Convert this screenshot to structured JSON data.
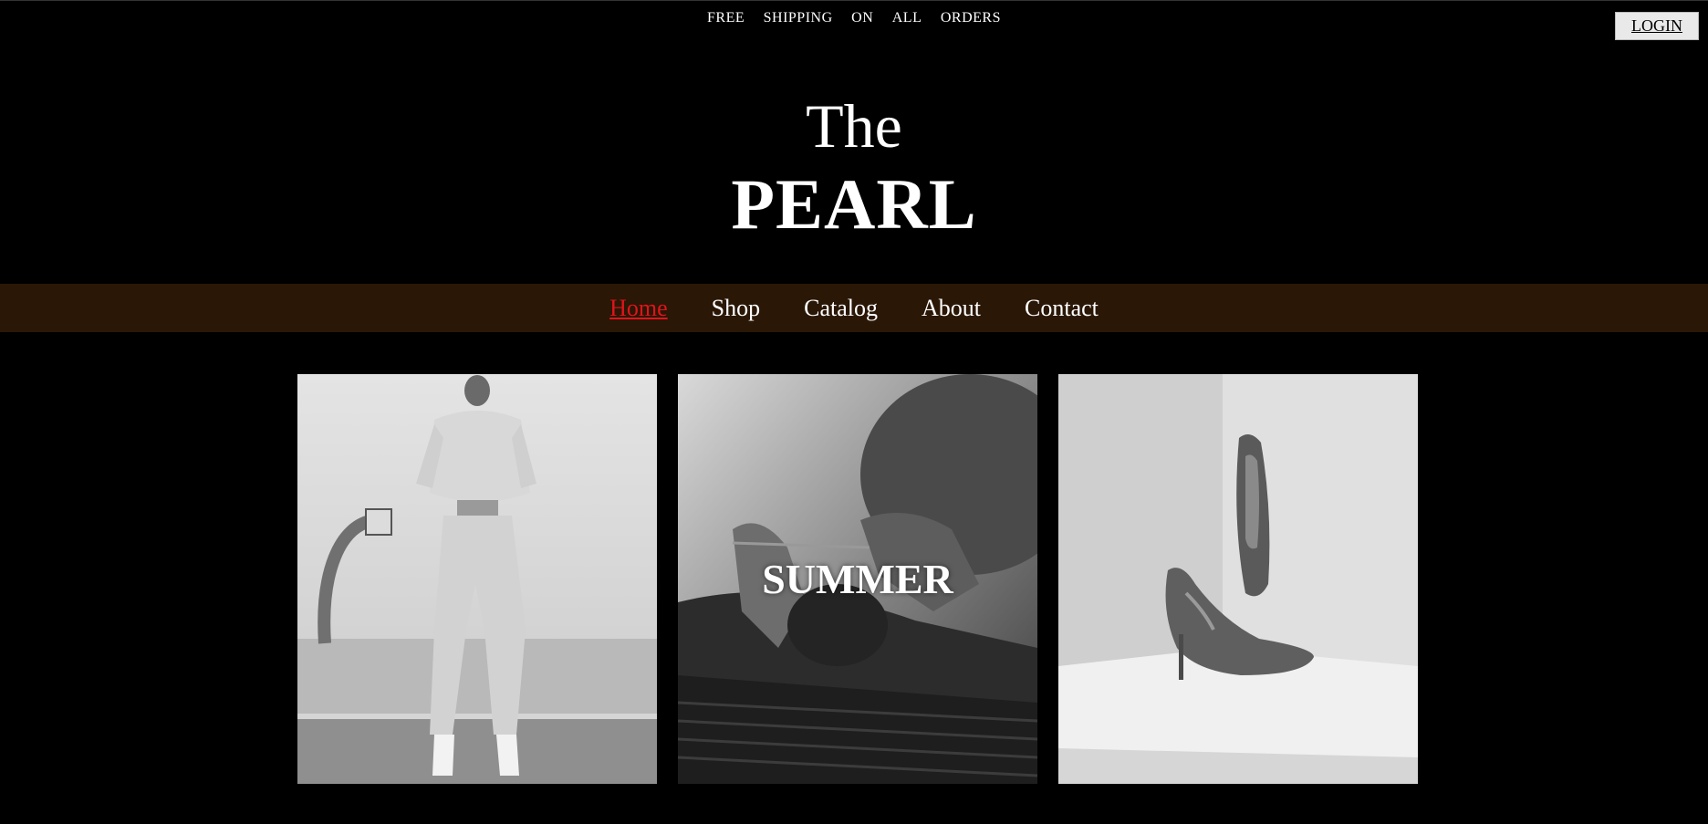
{
  "promo": {
    "words": [
      "FREE",
      "SHIPPING",
      "ON",
      "ALL",
      "ORDERS"
    ]
  },
  "header": {
    "login_label": "LOGIN",
    "brand_the": "The",
    "brand_name": "PEARL"
  },
  "nav": {
    "items": [
      {
        "label": "Home",
        "active": true
      },
      {
        "label": "Shop",
        "active": false
      },
      {
        "label": "Catalog",
        "active": false
      },
      {
        "label": "About",
        "active": false
      },
      {
        "label": "Contact",
        "active": false
      }
    ]
  },
  "gallery": {
    "cards": [
      {
        "image": "woman-in-sweatsuit-basketball-court-photo",
        "caption": ""
      },
      {
        "image": "hands-crocheting-photo",
        "caption": "SUMMER"
      },
      {
        "image": "floral-high-heels-photo",
        "caption": ""
      }
    ]
  },
  "colors": {
    "background": "#000000",
    "nav_bar": "#2a1706",
    "active_link": "#e0141b",
    "text": "#ffffff"
  }
}
